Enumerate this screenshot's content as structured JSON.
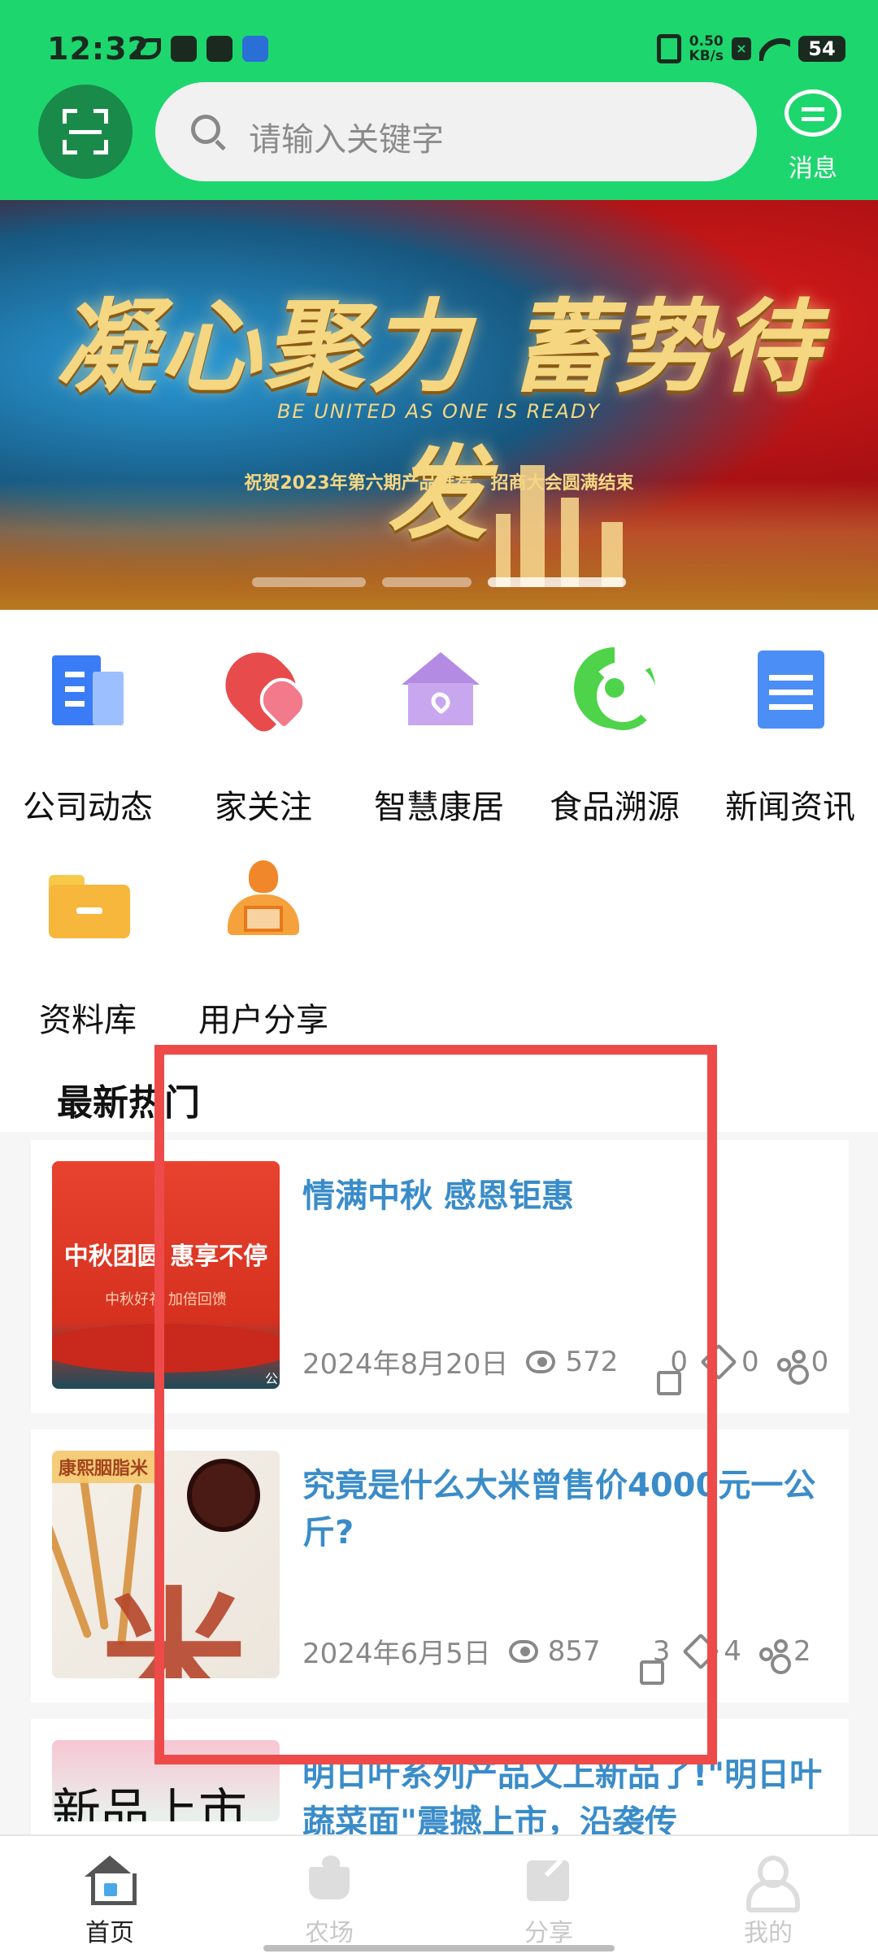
{
  "status_bar": {
    "time": "12:32",
    "net_speed": "0.50",
    "net_unit": "KB/s",
    "battery": "54"
  },
  "header": {
    "search_placeholder": "请输入关键字",
    "message_label": "消息"
  },
  "banner": {
    "title": "凝心聚力 蓄势待发",
    "english": "BE UNITED AS ONE IS READY",
    "subtitle": "祝贺2023年第六期产品推荐、招商大会圆满结束"
  },
  "features": [
    {
      "label": "公司动态",
      "icon": "document-icon"
    },
    {
      "label": "家关注",
      "icon": "hearts-icon"
    },
    {
      "label": "智慧康居",
      "icon": "house-icon"
    },
    {
      "label": "食品溯源",
      "icon": "radar-icon"
    },
    {
      "label": "新闻资讯",
      "icon": "news-icon"
    },
    {
      "label": "资料库",
      "icon": "folder-icon"
    },
    {
      "label": "用户分享",
      "icon": "user-share-icon"
    }
  ],
  "section_title": "最新热门",
  "articles": [
    {
      "title": "情满中秋 感恩钜惠",
      "date": "2024年8月20日",
      "views": "572",
      "likes": "0",
      "favorites": "0",
      "shares": "0",
      "thumb_text": "中秋团圆  惠享不停",
      "thumb_sub": "中秋好礼   加倍回馈",
      "thumb_corner": "公"
    },
    {
      "title": "究竟是什么大米曾售价4000元一公斤?",
      "date": "2024年6月5日",
      "views": "857",
      "likes": "3",
      "favorites": "4",
      "shares": "2",
      "thumb_tag": "康熙胭脂米",
      "thumb_big": "米"
    },
    {
      "title": "明日叶系列产品又上新品了!\"明日叶蔬菜面\"震撼上市，沿袭传",
      "thumb_text": "新品上市"
    }
  ],
  "bottom_nav": [
    {
      "label": "首页",
      "active": true
    },
    {
      "label": "农场",
      "active": false
    },
    {
      "label": "分享",
      "active": false
    },
    {
      "label": "我的",
      "active": false
    }
  ],
  "colors": {
    "brand_green": "#1ed66e",
    "title_blue": "#3a8cc9",
    "highlight_red": "#ee4a4a"
  }
}
